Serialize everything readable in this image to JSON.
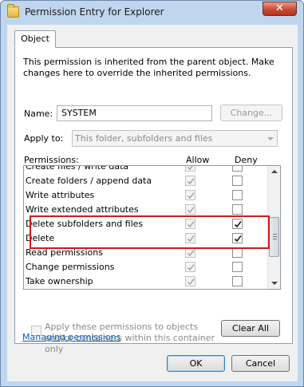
{
  "window": {
    "title": "Permission Entry for Explorer",
    "close_glyph": "✕"
  },
  "tabs": [
    {
      "label": "Object"
    }
  ],
  "info_text": "This permission is inherited from the parent object. Make changes here to override the inherited permissions.",
  "name": {
    "label": "Name:",
    "value": "SYSTEM",
    "change_label": "Change..."
  },
  "apply_to": {
    "label": "Apply to:",
    "value": "This folder, subfolders and files"
  },
  "permissions": {
    "label": "Permissions:",
    "allow_header": "Allow",
    "deny_header": "Deny",
    "rows": [
      {
        "name": "Create files / write data",
        "allow": true,
        "deny": false
      },
      {
        "name": "Create folders / append data",
        "allow": true,
        "deny": false
      },
      {
        "name": "Write attributes",
        "allow": true,
        "deny": false
      },
      {
        "name": "Write extended attributes",
        "allow": true,
        "deny": false
      },
      {
        "name": "Delete subfolders and files",
        "allow": true,
        "deny": true
      },
      {
        "name": "Delete",
        "allow": true,
        "deny": true
      },
      {
        "name": "Read permissions",
        "allow": true,
        "deny": false
      },
      {
        "name": "Change permissions",
        "allow": true,
        "deny": false
      },
      {
        "name": "Take ownership",
        "allow": true,
        "deny": false
      }
    ]
  },
  "apply_checkbox": {
    "label": "Apply these permissions to objects and/or containers within this container only",
    "checked": false
  },
  "clear_all_label": "Clear All",
  "managing_link": "Managing permissions",
  "buttons": {
    "ok": "OK",
    "cancel": "Cancel"
  },
  "colors": {
    "highlight": "#d11a1a",
    "link": "#0a5fb4",
    "frame": "#bfd6ee"
  }
}
